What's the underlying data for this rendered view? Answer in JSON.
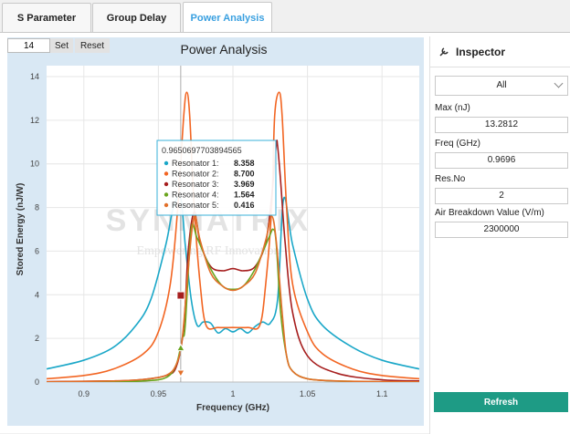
{
  "tabs": [
    {
      "label": "S Parameter",
      "active": false
    },
    {
      "label": "Group Delay",
      "active": false
    },
    {
      "label": "Power Analysis",
      "active": true
    }
  ],
  "toolbar": {
    "input_value": "14",
    "set_label": "Set",
    "reset_label": "Reset"
  },
  "inspector": {
    "title": "Inspector",
    "dropdown_value": "All",
    "fields": [
      {
        "label": "Max (nJ)",
        "value": "13.2812"
      },
      {
        "label": "Freq (GHz)",
        "value": "0.9696"
      },
      {
        "label": "Res.No",
        "value": "2"
      },
      {
        "label": "Air Breakdown Value (V/m)",
        "value": "2300000"
      }
    ],
    "refresh_label": "Refresh"
  },
  "chart_data": {
    "type": "line",
    "title": "Power Analysis",
    "xlabel": "Frequency (GHz)",
    "ylabel": "Stored Energy (nJ/W)",
    "xlim": [
      0.875,
      1.125
    ],
    "ylim": [
      0,
      14
    ],
    "xticks": [
      "0.9",
      "0.95",
      "1",
      "1.05",
      "1.1"
    ],
    "yticks": [
      "0",
      "2",
      "4",
      "6",
      "8",
      "10",
      "12",
      "14"
    ],
    "watermark": "SYNMATRIX",
    "watermark_sub": "Empowering RF Innovation",
    "colors": {
      "plot_bg": "#d9e8f4",
      "r1": "#1aa7c8",
      "r2": "#f26522",
      "r3": "#a61e1e",
      "r4": "#6aa51e",
      "r5": "#e2702a"
    },
    "series": [
      {
        "name": "Resonator 1",
        "x": [
          0.875,
          0.9,
          0.92,
          0.935,
          0.945,
          0.955,
          0.96,
          0.965,
          0.968,
          0.972,
          0.976,
          0.98,
          0.985,
          0.99,
          0.995,
          1,
          1.005,
          1.01,
          1.015,
          1.02,
          1.025,
          1.03,
          1.034,
          1.04,
          1.05,
          1.06,
          1.08,
          1.1,
          1.125
        ],
        "y": [
          0.6,
          1.0,
          1.6,
          2.6,
          3.8,
          6.3,
          8.0,
          8.4,
          6.3,
          3.8,
          2.6,
          2.75,
          2.7,
          2.25,
          2.45,
          2.3,
          2.45,
          2.25,
          2.55,
          2.75,
          2.7,
          3.8,
          8.4,
          6.3,
          3.8,
          2.6,
          1.6,
          1.0,
          0.6
        ]
      },
      {
        "name": "Resonator 2",
        "x": [
          0.875,
          0.9,
          0.92,
          0.94,
          0.95,
          0.958,
          0.963,
          0.967,
          0.969,
          0.971,
          0.974,
          0.978,
          0.982,
          0.99,
          1,
          1.01,
          1.018,
          1.022,
          1.026,
          1.028,
          1.031,
          1.033,
          1.036,
          1.04,
          1.05,
          1.06,
          1.08,
          1.1,
          1.125
        ],
        "y": [
          0.15,
          0.3,
          0.6,
          1.3,
          2.3,
          4.5,
          8.0,
          12.2,
          13.28,
          12.2,
          8.0,
          4.5,
          2.6,
          2.5,
          2.5,
          2.5,
          2.6,
          4.5,
          8.0,
          12.2,
          13.28,
          12.2,
          8.0,
          4.5,
          2.3,
          1.3,
          0.6,
          0.3,
          0.15
        ]
      },
      {
        "name": "Resonator 3",
        "x": [
          0.875,
          0.92,
          0.94,
          0.955,
          0.962,
          0.967,
          0.97,
          0.974,
          0.978,
          0.985,
          0.993,
          1.0,
          1.007,
          1.015,
          1.022,
          1.026,
          1.029,
          1.03,
          1.032,
          1.035,
          1.04,
          1.05,
          1.07,
          1.1,
          1.125
        ],
        "y": [
          0.02,
          0.05,
          0.12,
          0.3,
          0.7,
          2.5,
          6.0,
          7.8,
          6.4,
          5.3,
          5.1,
          5.2,
          5.1,
          5.3,
          6.4,
          8.5,
          10.85,
          10.8,
          9.2,
          6.4,
          3.2,
          1.2,
          0.4,
          0.1,
          0.05
        ]
      },
      {
        "name": "Resonator 4",
        "x": [
          0.875,
          0.92,
          0.94,
          0.955,
          0.962,
          0.966,
          0.968,
          0.972,
          0.976,
          0.985,
          0.993,
          1.0,
          1.007,
          1.015,
          1.024,
          1.027,
          1.029,
          1.032,
          1.036,
          1.04,
          1.05,
          1.07,
          1.1,
          1.125
        ],
        "y": [
          0.0,
          0.02,
          0.05,
          0.2,
          0.8,
          2.0,
          2.6,
          7.0,
          6.6,
          5.2,
          4.4,
          4.25,
          4.4,
          5.2,
          6.6,
          7.0,
          6.4,
          3.2,
          1.2,
          0.5,
          0.15,
          0.05,
          0.01,
          0.0
        ]
      },
      {
        "name": "Resonator 5",
        "x": [
          0.875,
          0.92,
          0.94,
          0.955,
          0.962,
          0.966,
          0.97,
          0.974,
          0.978,
          0.985,
          0.993,
          1.0,
          1.007,
          1.015,
          1.022,
          1.026,
          1.029,
          1.033,
          1.036,
          1.04,
          1.05,
          1.07,
          1.1,
          1.125
        ],
        "y": [
          0.01,
          0.05,
          0.12,
          0.3,
          0.8,
          2.0,
          5.2,
          7.6,
          6.5,
          5.0,
          4.4,
          4.2,
          4.4,
          5.0,
          6.5,
          7.6,
          6.5,
          3.2,
          1.2,
          0.5,
          0.15,
          0.05,
          0.02,
          0.01
        ]
      }
    ],
    "tooltip": {
      "header": "0.9650697703894565",
      "rows": [
        {
          "label": "Resonator 1:",
          "value": "8.358"
        },
        {
          "label": "Resonator 2:",
          "value": "8.700"
        },
        {
          "label": "Resonator 3:",
          "value": "3.969"
        },
        {
          "label": "Resonator 4:",
          "value": "1.564"
        },
        {
          "label": "Resonator 5:",
          "value": "0.416"
        }
      ]
    },
    "hover_x": 0.965,
    "hover_markers": [
      3.969,
      1.564,
      0.416
    ]
  }
}
